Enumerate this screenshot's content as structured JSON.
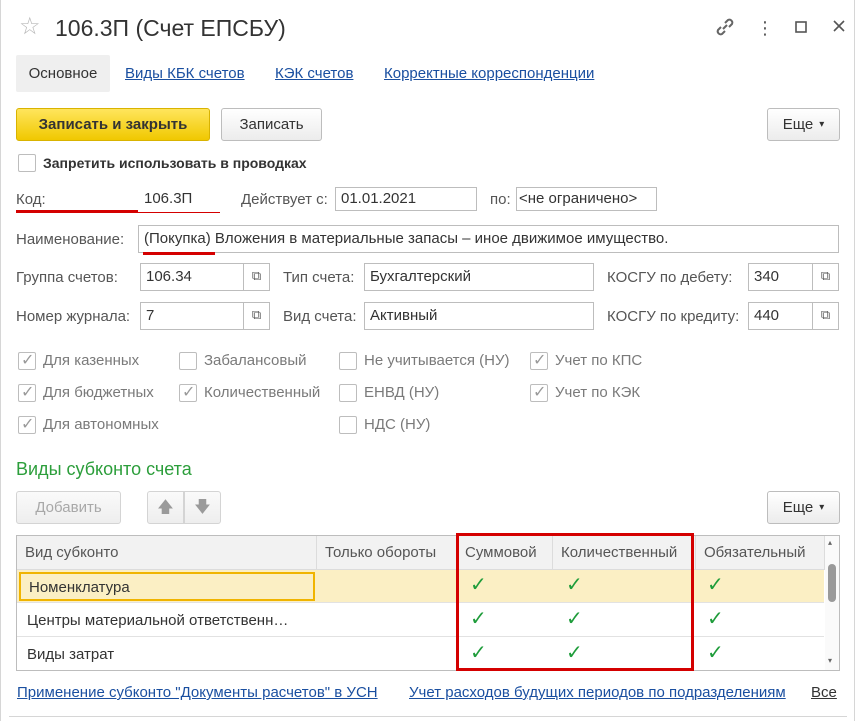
{
  "window": {
    "title": "106.3П (Счет ЕПСБУ)"
  },
  "tabs": [
    {
      "label": "Основное"
    },
    {
      "label": "Виды КБК счетов"
    },
    {
      "label": "КЭК счетов"
    },
    {
      "label": "Корректные корреспонденции"
    }
  ],
  "toolbar": {
    "save_close_label": "Записать и закрыть",
    "save_label": "Записать",
    "more_label": "Еще"
  },
  "forbid": {
    "label": "Запретить использовать в проводках",
    "checked": false
  },
  "code": {
    "label": "Код:",
    "value": "106.3П"
  },
  "valid_from": {
    "label": "Действует с:",
    "value": "01.01.2021"
  },
  "valid_to": {
    "label": "по:",
    "value": "<не ограничено>"
  },
  "name": {
    "label": "Наименование:",
    "value": "(Покупка) Вложения в материальные запасы – иное движимое имущество."
  },
  "group": {
    "label": "Группа счетов:",
    "value": "106.34"
  },
  "account_type": {
    "label": "Тип счета:",
    "value": "Бухгалтерский"
  },
  "kosgu_debit": {
    "label": "КОСГУ по дебету:",
    "value": "340"
  },
  "journal": {
    "label": "Номер журнала:",
    "value": "7"
  },
  "account_kind": {
    "label": "Вид счета:",
    "value": "Активный"
  },
  "kosgu_credit": {
    "label": "КОСГУ по кредиту:",
    "value": "440"
  },
  "flags": [
    {
      "label": "Для казенных",
      "checked": true
    },
    {
      "label": "Для бюджетных",
      "checked": true
    },
    {
      "label": "Для автономных",
      "checked": true
    },
    {
      "label": "Забалансовый",
      "checked": false
    },
    {
      "label": "Количественный",
      "checked": true
    },
    {
      "label": "Не учитывается (НУ)",
      "checked": false
    },
    {
      "label": "ЕНВД (НУ)",
      "checked": false
    },
    {
      "label": "НДС (НУ)",
      "checked": false
    },
    {
      "label": "Учет по КПС",
      "checked": true
    },
    {
      "label": "Учет по КЭК",
      "checked": true
    }
  ],
  "subconto": {
    "title": "Виды субконто счета",
    "add_label": "Добавить",
    "more_label": "Еще",
    "columns": [
      "Вид субконто",
      "Только обороты",
      "Суммовой",
      "Количественный",
      "Обязательный"
    ],
    "rows": [
      {
        "name": "Номенклатура",
        "turnover_only": false,
        "sum": true,
        "quantity": true,
        "required": true
      },
      {
        "name": "Центры материальной ответственн…",
        "turnover_only": false,
        "sum": true,
        "quantity": true,
        "required": true
      },
      {
        "name": "Виды затрат",
        "turnover_only": false,
        "sum": true,
        "quantity": true,
        "required": true
      }
    ]
  },
  "bottom_links": [
    {
      "label": "Применение субконто \"Документы расчетов\" в УСН"
    },
    {
      "label": "Учет расходов будущих периодов по подразделениям"
    },
    {
      "label": "Все"
    }
  ],
  "colors": {
    "accent_yellow": "#f5d21a",
    "link": "#1a4fa0",
    "section_green": "#2c9e3b",
    "highlight_red": "#d40000",
    "check_green": "#1e9c3a",
    "selected_row": "#fbefc4"
  }
}
